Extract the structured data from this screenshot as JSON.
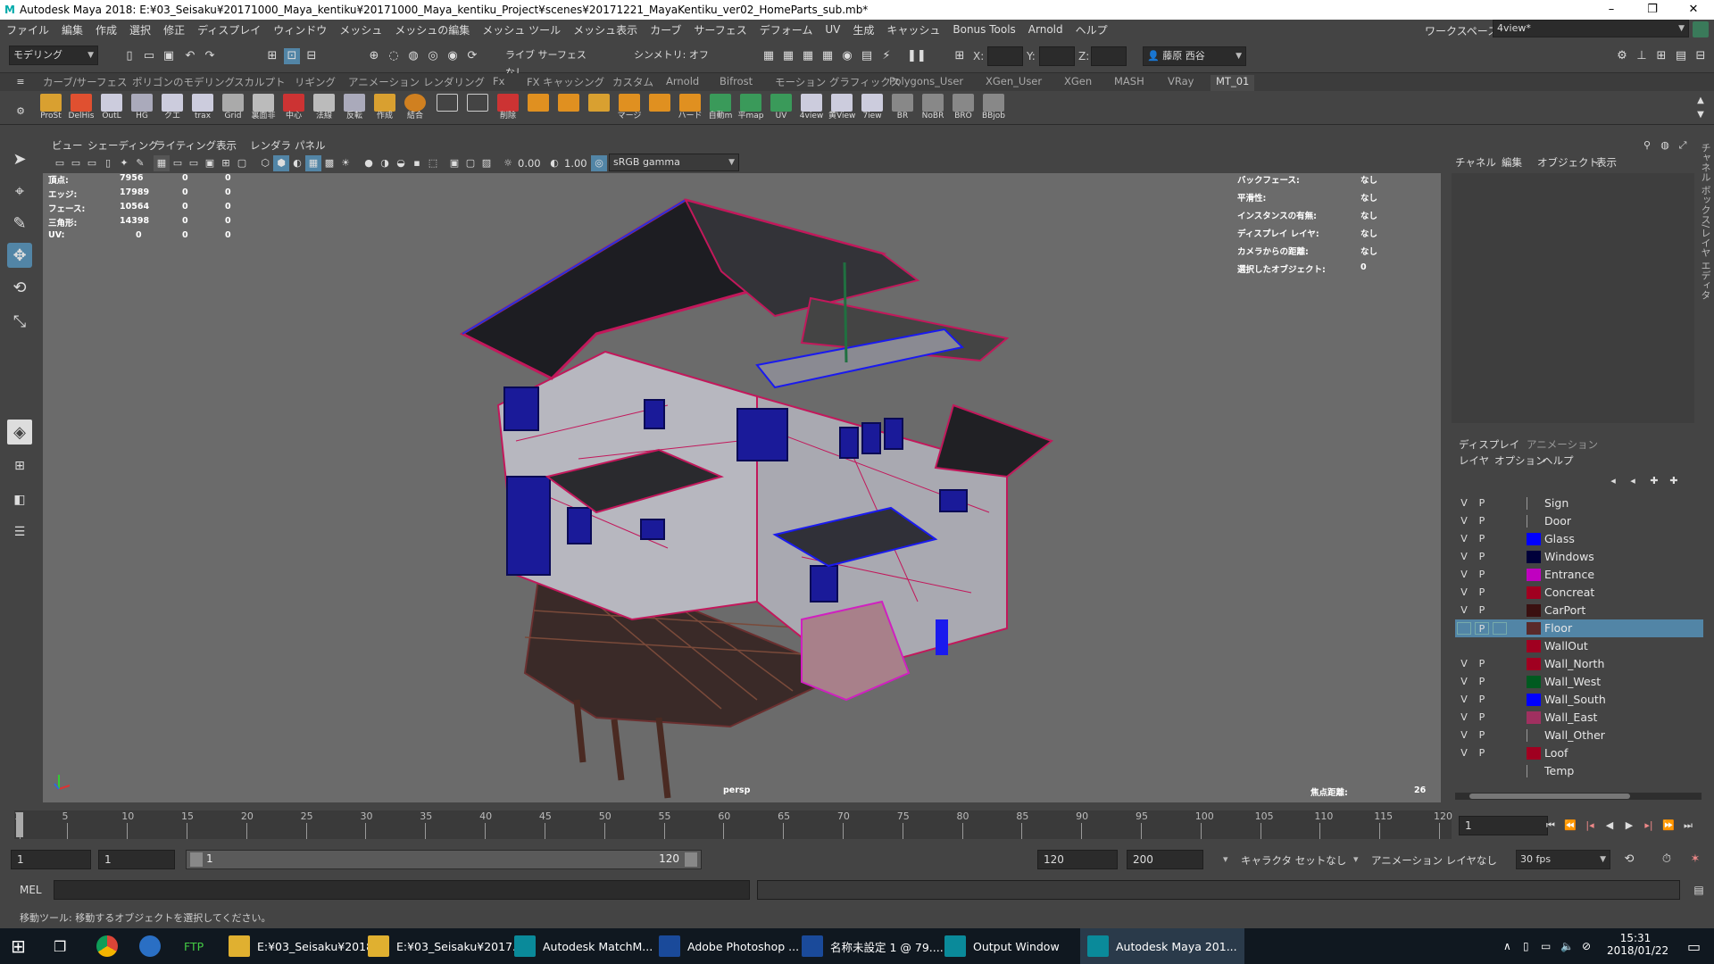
{
  "window": {
    "title": "Autodesk Maya 2018: E:¥03_Seisaku¥20171000_Maya_kentiku¥20171000_Maya_kentiku_Project¥scenes¥20171221_MayaKentiku_ver02_HomeParts_sub.mb*",
    "minimize": "–",
    "restore": "❐",
    "close": "✕"
  },
  "menubar": {
    "items": [
      "ファイル",
      "編集",
      "作成",
      "選択",
      "修正",
      "ディスプレイ",
      "ウィンドウ",
      "メッシュ",
      "メッシュの編集",
      "メッシュ ツール",
      "メッシュ表示",
      "カーブ",
      "サーフェス",
      "デフォーム",
      "UV",
      "生成",
      "キャッシュ",
      "Bonus Tools",
      "Arnold",
      "ヘルプ"
    ],
    "workspace_label": "ワークスペース:",
    "workspace_value": "4view*"
  },
  "statusline": {
    "mode": "モデリング",
    "live": "ライブ サーフェスなし",
    "symmetry": "シンメトリ: オフ",
    "x_label": "X:",
    "y_label": "Y:",
    "z_label": "Z:",
    "user": "藤原 西谷"
  },
  "shelf_tabs": [
    "カーブ/サーフェス",
    "ポリゴンのモデリング",
    "スカルプト",
    "リギング",
    "アニメーション",
    "レンダリング",
    "Fx",
    "FX キャッシング",
    "カスタム",
    "Arnold",
    "Bifrost",
    "モーション グラフィックス",
    "Polygons_User",
    "XGen_User",
    "XGen",
    "MASH",
    "VRay",
    "MT_01"
  ],
  "shelf_buttons": [
    "ProSt",
    "DelHis",
    "OutL",
    "HG",
    "クエ",
    "trax",
    "Grid",
    "裏面非",
    "中心",
    "法線",
    "反転",
    "作成",
    "結合",
    "",
    "",
    "削除",
    "",
    "",
    "",
    "マージ",
    "",
    "ハード",
    "自動m",
    "平map",
    "UV",
    "4view",
    "黄View",
    "7iew",
    "BR",
    "NoBR",
    "BRO",
    "BBjob"
  ],
  "viewport_menu": [
    "ビュー",
    "シェーディング",
    "ライティング",
    "表示",
    "レンダラ",
    "パネル"
  ],
  "viewport_toolbar": {
    "val1": "0.00",
    "val2": "1.00",
    "colorspace": "sRGB gamma"
  },
  "hud_left": [
    {
      "label": "頂点:",
      "a": "7956",
      "b": "0",
      "c": "0"
    },
    {
      "label": "エッジ:",
      "a": "17989",
      "b": "0",
      "c": "0"
    },
    {
      "label": "フェース:",
      "a": "10564",
      "b": "0",
      "c": "0"
    },
    {
      "label": "三角形:",
      "a": "14398",
      "b": "0",
      "c": "0"
    },
    {
      "label": "UV:",
      "a": "0",
      "b": "0",
      "c": "0"
    }
  ],
  "hud_right": [
    {
      "label": "バックフェース:",
      "value": "なし"
    },
    {
      "label": "平滑性:",
      "value": "なし"
    },
    {
      "label": "インスタンスの有無:",
      "value": "なし"
    },
    {
      "label": "ディスプレイ レイヤ:",
      "value": "なし"
    },
    {
      "label": "カメラからの距離:",
      "value": "なし"
    },
    {
      "label": "選択したオブジェクト:",
      "value": "0"
    }
  ],
  "camera_name": "persp",
  "focus": {
    "label": "焦点距離:",
    "value": "26"
  },
  "channel_box": {
    "menu": [
      "チャネル",
      "編集",
      "オブジェクト",
      "表示"
    ]
  },
  "layer_editor": {
    "tabs": [
      "ディスプレイ",
      "アニメーション"
    ],
    "menu": [
      "レイヤ",
      "オプション",
      "ヘルプ"
    ],
    "layers": [
      {
        "v": "V",
        "p": "P",
        "name": "Sign",
        "color": "none",
        "selected": false
      },
      {
        "v": "V",
        "p": "P",
        "name": "Door",
        "color": "none",
        "selected": false
      },
      {
        "v": "V",
        "p": "P",
        "name": "Glass",
        "color": "#0000ff",
        "selected": false
      },
      {
        "v": "V",
        "p": "P",
        "name": "Windows",
        "color": "#00003a",
        "selected": false
      },
      {
        "v": "V",
        "p": "P",
        "name": "Entrance",
        "color": "#c000c0",
        "selected": false
      },
      {
        "v": "V",
        "p": "P",
        "name": "Concreat",
        "color": "#a00020",
        "selected": false
      },
      {
        "v": "V",
        "p": "P",
        "name": "CarPort",
        "color": "#3a1010",
        "selected": false
      },
      {
        "v": "",
        "p": "P",
        "name": "Floor",
        "color": "#5a2a2a",
        "selected": true
      },
      {
        "v": "",
        "p": "",
        "name": "WallOut",
        "color": "#a00020",
        "selected": false
      },
      {
        "v": "V",
        "p": "P",
        "name": "Wall_North",
        "color": "#a00020",
        "selected": false
      },
      {
        "v": "V",
        "p": "P",
        "name": "Wall_West",
        "color": "#005a20",
        "selected": false
      },
      {
        "v": "V",
        "p": "P",
        "name": "Wall_South",
        "color": "#0000ff",
        "selected": false
      },
      {
        "v": "V",
        "p": "P",
        "name": "Wall_East",
        "color": "#a03060",
        "selected": false
      },
      {
        "v": "V",
        "p": "P",
        "name": "Wall_Other",
        "color": "none",
        "selected": false
      },
      {
        "v": "V",
        "p": "P",
        "name": "Loof",
        "color": "#a00020",
        "selected": false
      },
      {
        "v": "",
        "p": "",
        "name": "Temp",
        "color": "none",
        "selected": false
      }
    ]
  },
  "timeline": {
    "ticks": [
      "1",
      "5",
      "10",
      "15",
      "20",
      "25",
      "30",
      "35",
      "40",
      "45",
      "50",
      "55",
      "60",
      "65",
      "70",
      "75",
      "80",
      "85",
      "90",
      "95",
      "100",
      "105",
      "110",
      "115",
      "120"
    ],
    "current_frame": "1"
  },
  "range": {
    "start": "1",
    "anim_start": "1",
    "slider_start": "1",
    "slider_end": "120",
    "anim_end": "120",
    "end": "200",
    "character_set": "キャラクタ セットなし",
    "anim_layer": "アニメーション レイヤなし",
    "fps": "30 fps"
  },
  "cmdline": {
    "label": "MEL"
  },
  "helpline": "移動ツール: 移動するオブジェクトを選択してください。",
  "taskbar": {
    "items": [
      {
        "label": "E:¥03_Seisaku¥2018...",
        "color": "#e0b030"
      },
      {
        "label": "E:¥03_Seisaku¥2017...",
        "color": "#e0b030"
      },
      {
        "label": "Autodesk MatchM...",
        "color": "#0aa"
      },
      {
        "label": "Adobe Photoshop ...",
        "color": "#1a6fd0"
      },
      {
        "label": "名称未設定 1 @ 79....",
        "color": "#1a6fd0"
      },
      {
        "label": "Output Window",
        "color": "#0aa"
      },
      {
        "label": "Autodesk Maya 201...",
        "color": "#0aa"
      }
    ],
    "time": "15:31",
    "date": "2018/01/22"
  }
}
